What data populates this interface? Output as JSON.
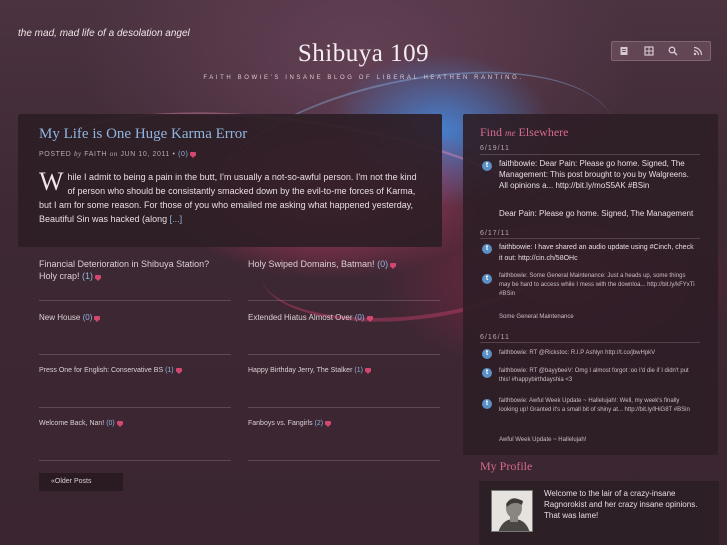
{
  "header": {
    "tagline": "the mad, mad life of a desolation angel",
    "title": "Shibuya 109",
    "subtitle": "Faith Bowie's insane blog of liberal heathen ranting."
  },
  "toolbar": {
    "icons": [
      "document-icon",
      "grid-icon",
      "search-icon",
      "rss-icon"
    ]
  },
  "post": {
    "title": "My Life is One Huge Karma Error",
    "meta_posted": "POSTED",
    "meta_by": "by",
    "meta_author": "FAITH",
    "meta_on": "on",
    "meta_date": "JUN 10, 2011",
    "meta_sep": "•",
    "meta_comments": "(0)",
    "dropcap": "W",
    "body": "hile I admit to being a pain in the butt, I'm usually a not-so-awful person. I'm not the kind of person who should be consistantly smacked down by the evil-to-me forces of Karma, but I am for some reason. For those of you who emailed me asking what happened yesterday, Beautiful Sin was hacked (along ",
    "more": "[...]"
  },
  "older_posts": [
    {
      "title": "Financial Deterioration in Shibuya Station? Holy crap!",
      "comments": "(1)"
    },
    {
      "title": "Holy Swiped Domains, Batman!",
      "comments": "(0)"
    },
    {
      "title": "New House",
      "comments": "(0)"
    },
    {
      "title": "Extended Hiatus Almost Over",
      "comments": "(0)"
    },
    {
      "title": "Press One for English: Conservative BS",
      "comments": "(1)"
    },
    {
      "title": "Happy Birthday Jerry, The Stalker",
      "comments": "(1)"
    },
    {
      "title": "Welcome Back, Nan!",
      "comments": "(0)"
    },
    {
      "title": "Fanboys vs. Fangirls",
      "comments": "(2)"
    }
  ],
  "older_button": "«Older Posts",
  "sidebar": {
    "heading_find": "Find",
    "heading_me": "me",
    "heading_elsewhere": "Elsewhere",
    "groups": [
      {
        "date": "6/19/11",
        "tweets": [
          {
            "text": "faithbowie: Dear Pain: Please go home. Signed, The Management: This post brought to you by Walgreens. All opinions a... http://bit.ly/moS5AK #BSin",
            "sub": "Dear Pain: Please go home. Signed, The Management"
          }
        ]
      },
      {
        "date": "6/17/11",
        "tweets": [
          {
            "text": "faithbowie: I have shared an audio update using #Cinch, check it out: http://cin.ch/58OHc",
            "sub": ""
          },
          {
            "text": "faithbowie: Some General Maintenance: Just a heads up, some things may be hard to access while I mess with the downloa... http://bit.ly/kFYxTi #BSin",
            "sub": "Some General Maintenance"
          }
        ]
      },
      {
        "date": "6/16/11",
        "tweets": [
          {
            "text": "faithbowie: RT @Rickstoc: R.I.P Ashlyn http://t.co/jbwHpkV",
            "sub": ""
          },
          {
            "text": "faithbowie: RT @bayybeeV: Omg I almost forgot :oo I'd die if I didn't put this! #happybirthdayshia <3",
            "sub": ""
          },
          {
            "text": "faithbowie: Awful Week Update ~ Hallelujah!: Well, my week's finally looking up! Granted it's a small bit of shiny at... http://bit.ly/lHiG8T #BSin",
            "sub": "Awful Week Update ~ Hallelujah!"
          }
        ]
      }
    ]
  },
  "profile": {
    "heading": "My Profile",
    "text": "Welcome to the lair of a crazy-insane Ragnorokist and her crazy insane opinions. That was lame!"
  },
  "colors": {
    "link": "#8fb6de",
    "heading_accent": "#d66a8e",
    "comment_bubble": "#d1476e",
    "panel": "#2d1e26"
  }
}
